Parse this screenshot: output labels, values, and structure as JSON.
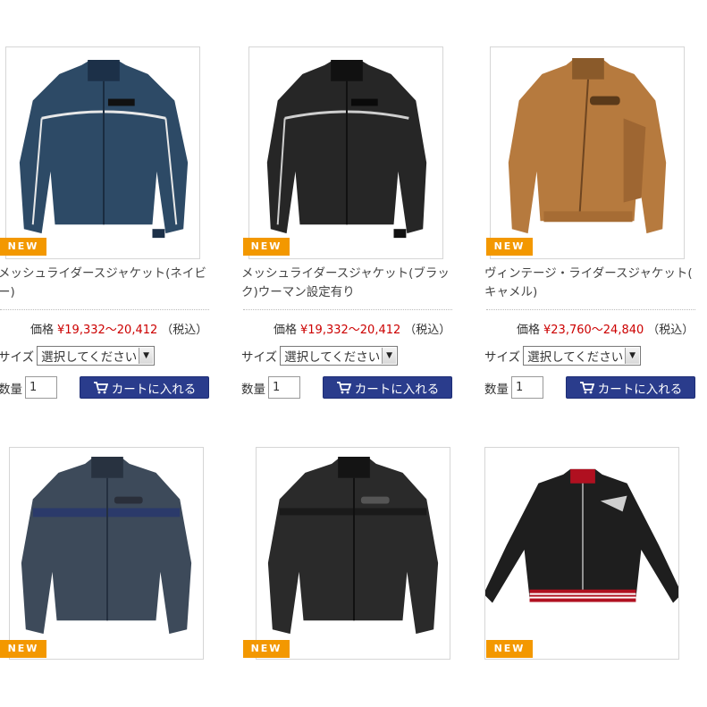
{
  "products": [
    {
      "badge": "NEW",
      "title_line1": "メッシュライダースジャケット(ネイビ",
      "title_line2": "ー)",
      "price_label": "価格",
      "price": "¥19,332～20,412",
      "tax": "（税込）",
      "size_label": "サイズ",
      "size_select": "選択してください",
      "qty_label": "数量",
      "qty_value": "1",
      "cart_label": "カートに入れる",
      "jacket_color": "#2d4a66"
    },
    {
      "badge": "NEW",
      "title_line1": "メッシュライダースジャケット(ブラッ",
      "title_line2": "ク)ウーマン設定有り",
      "price_label": "価格",
      "price": "¥19,332～20,412",
      "tax": "（税込）",
      "size_label": "サイズ",
      "size_select": "選択してください",
      "qty_label": "数量",
      "qty_value": "1",
      "cart_label": "カートに入れる",
      "jacket_color": "#262626"
    },
    {
      "badge": "NEW",
      "title_line1": "ヴィンテージ・ライダースジャケット(",
      "title_line2": "キャメル)",
      "price_label": "価格",
      "price": "¥23,760～24,840",
      "tax": "（税込）",
      "size_label": "サイズ",
      "size_select": "選択してください",
      "qty_label": "数量",
      "qty_value": "1",
      "cart_label": "カートに入れる",
      "jacket_color": "#b67a3e"
    },
    {
      "badge": "NEW",
      "jacket_color": "#3d4a5a"
    },
    {
      "badge": "NEW",
      "jacket_color": "#2a2a2a"
    },
    {
      "badge": "NEW",
      "jacket_color": "#1e1e1e"
    }
  ],
  "colors": {
    "badge": "#f39800",
    "price": "#cc0000",
    "cart_button": "#2a3c8c"
  },
  "icons": {
    "cart": "cart-icon",
    "dropdown": "chevron-down-icon"
  }
}
